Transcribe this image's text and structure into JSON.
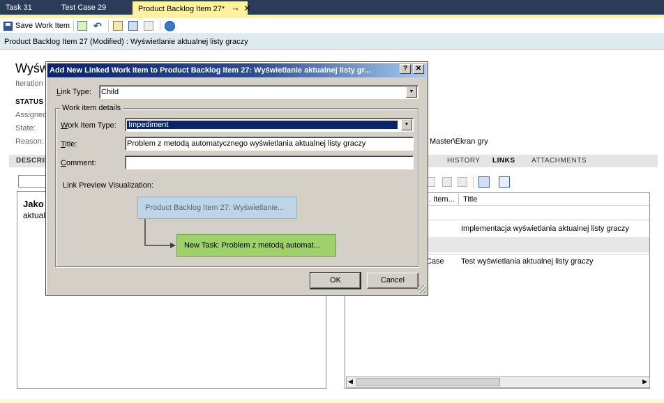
{
  "tabs": [
    {
      "label": "Task 31"
    },
    {
      "label": "Test Case 29"
    },
    {
      "label": "Product Backlog Item 27*",
      "pin_icon": "pin-icon",
      "close_icon": "close-icon"
    }
  ],
  "toolbar": {
    "save_label": "Save Work Item"
  },
  "info_bar": "Product Backlog Item 27 (Modified) : Wyświetlanie aktualnej listy graczy",
  "background": {
    "title_partial": "Wyśw",
    "iteration_label": "Iteration",
    "status_heading": "STATUS",
    "assigned_label": "Assigned",
    "state_label": "State:",
    "reason_label": "Reason:",
    "area_value_partial": "Master\\Ekran gry",
    "tabs": {
      "description_partial": "DESCRIP",
      "history": "HISTORY",
      "links": "LINKS",
      "attachments": "ATTACHMENTS"
    },
    "desc_text_1": "Jako",
    "desc_text_2": "aktual",
    "links_columns": {
      "item_partial": ". Item...",
      "title": "Title"
    },
    "links_rows": [
      {
        "type": "",
        "title": "Implementacja wyświetlania aktualnej listy graczy"
      },
      {
        "type": "Case",
        "title": "Test wyświetlania aktualnej listy graczy"
      }
    ]
  },
  "dialog": {
    "title": "Add New Linked Work Item to Product Backlog Item 27: Wyświetlanie aktualnej listy gr...",
    "help_button": "?",
    "close_button": "✕",
    "link_type_label_u": "L",
    "link_type_label_rest": "ink Type:",
    "link_type_value": "Child",
    "group_caption": "Work item details",
    "wit_label_u": "W",
    "wit_label_rest": "ork Item Type:",
    "wit_value": "Impediment",
    "title_label_u": "T",
    "title_label_rest": "itle:",
    "title_value": "Problem z metodą automatycznego wyświetlania aktualnej listy graczy",
    "comment_label_u": "C",
    "comment_label_rest": "omment:",
    "comment_value": "",
    "preview_label": "Link Preview Visualization:",
    "preview_parent": "Product Backlog Item 27: Wyświetlanie...",
    "preview_child": "New Task: Problem z metodą automat...",
    "ok_label": "OK",
    "cancel_label": "Cancel"
  },
  "colors": {
    "tab_strip": "#2b3c59",
    "active_tab": "#fff29d",
    "dialog_face": "#d4d0c8",
    "title_bar": "#0a246a",
    "preview_parent": "#bfd4e6",
    "preview_child": "#9ed16a",
    "selection": "#0a246a"
  }
}
